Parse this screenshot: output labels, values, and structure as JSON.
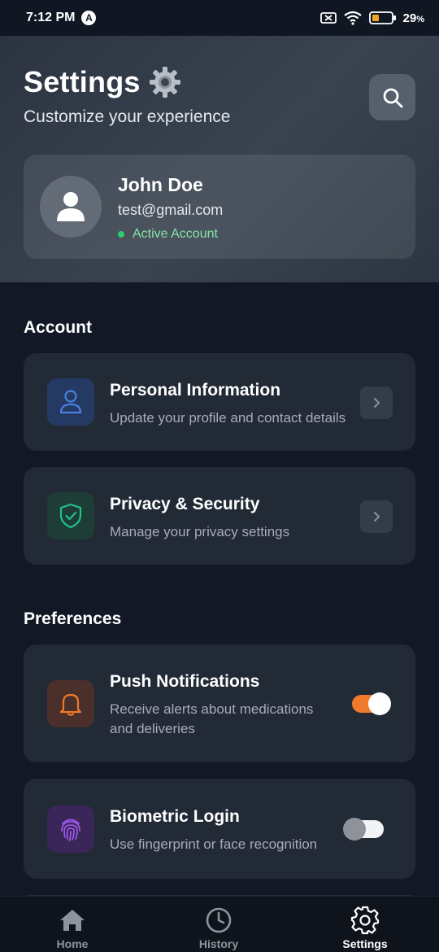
{
  "status_bar": {
    "time": "7:12 PM",
    "network_badge": "A",
    "battery": "29",
    "battery_unit": "%"
  },
  "header": {
    "title": "Settings",
    "subtitle": "Customize your experience",
    "title_icon": "gear-icon",
    "search_icon": "search-icon"
  },
  "profile": {
    "name": "John Doe",
    "email": "test@gmail.com",
    "status": "Active Account",
    "status_color": "#2ecc71"
  },
  "sections": {
    "account": {
      "title": "Account",
      "items": [
        {
          "title": "Personal Information",
          "description": "Update your profile and contact details",
          "icon": "user-icon",
          "icon_color": "#4a7fe0"
        },
        {
          "title": "Privacy & Security",
          "description": "Manage your privacy settings",
          "icon": "shield-icon",
          "icon_color": "#22c08a"
        }
      ]
    },
    "preferences": {
      "title": "Preferences",
      "items": [
        {
          "title": "Push Notifications",
          "description_line1": "Receive alerts about medications",
          "description_line2": "and deliveries",
          "icon": "bell-icon",
          "icon_color": "#f07a2c",
          "enabled": true
        },
        {
          "title": "Biometric Login",
          "description": "Use fingerprint or face recognition",
          "icon": "fingerprint-icon",
          "icon_color": "#9a56e6",
          "enabled": false
        }
      ]
    }
  },
  "bottom_nav": {
    "items": [
      {
        "label": "Home",
        "icon": "home-icon",
        "active": false
      },
      {
        "label": "History",
        "icon": "clock-icon",
        "active": false
      },
      {
        "label": "Settings",
        "icon": "gear-icon",
        "active": true
      }
    ]
  },
  "colors": {
    "accent_toggle": "#f07a2c",
    "background": "#121826",
    "card": "#222a36"
  }
}
